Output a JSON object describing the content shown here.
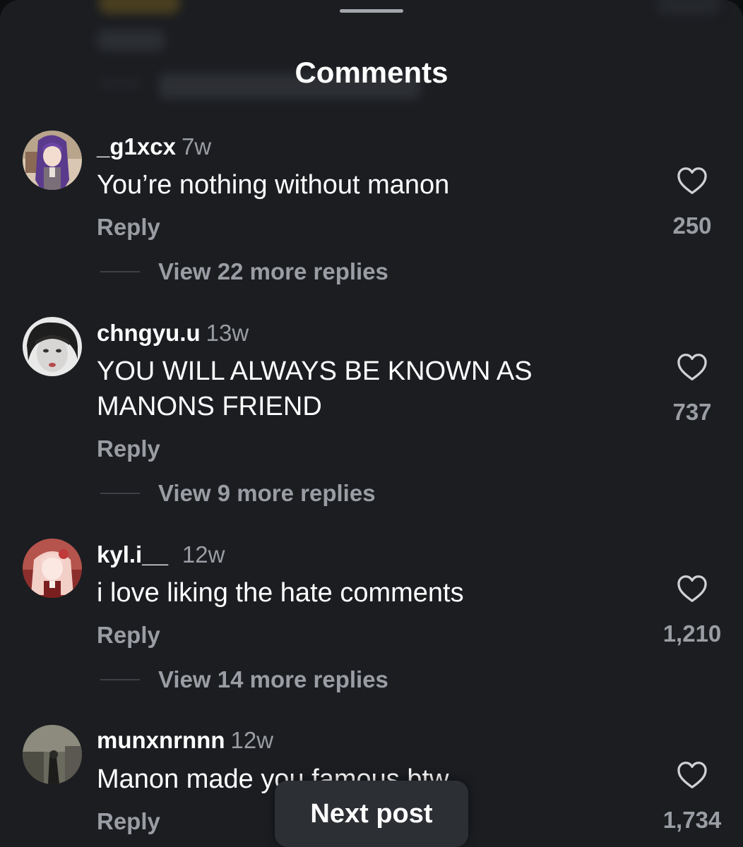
{
  "sheet": {
    "title": "Comments",
    "next_post_label": "Next post"
  },
  "comments": [
    {
      "username": "_g1xcx",
      "time": "7w",
      "text": "You’re nothing without manon",
      "reply_label": "Reply",
      "view_replies": "View 22 more replies",
      "likes": "250",
      "avatar": "anime-girl-purple-hair-avatar"
    },
    {
      "username": "chngyu.u",
      "time": "13w",
      "text": "YOU WILL ALWAYS BE KNOWN AS MANONS FRIEND",
      "reply_label": "Reply",
      "view_replies": "View 9 more replies",
      "likes": "737",
      "avatar": "monochrome-face-avatar"
    },
    {
      "username": "kyl.i__",
      "time": "12w",
      "text": "i love liking the hate comments",
      "reply_label": "Reply",
      "view_replies": "View 14 more replies",
      "likes": "1,210",
      "avatar": "anime-girl-pink-hair-avatar"
    },
    {
      "username": "munxnrnnn",
      "time": "12w",
      "text": "Manon made you famous btw",
      "reply_label": "Reply",
      "likes": "1,734",
      "avatar": "photo-figure-avatar"
    }
  ],
  "colors": {
    "background": "#1b1d21",
    "primary_text": "#ffffff",
    "secondary_text": "#9a9da3",
    "button_bg": "#2c2f34"
  }
}
